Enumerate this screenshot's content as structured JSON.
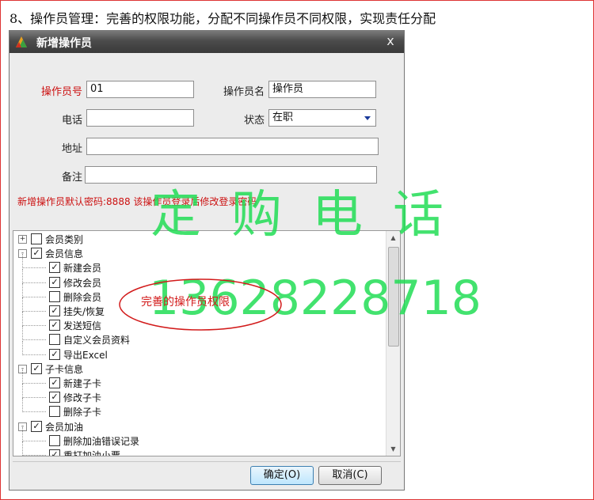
{
  "caption": "8、操作员管理：完善的权限功能，分配不同操作员不同权限，实现责任分配",
  "dialog": {
    "title": "新增操作员",
    "close_label": "x",
    "fields": {
      "op_no_label": "操作员号",
      "op_no_value": "01",
      "op_name_label": "操作员名",
      "op_name_value": "操作员",
      "phone_label": "电话",
      "phone_value": "",
      "status_label": "状态",
      "status_value": "在职",
      "address_label": "地址",
      "address_value": "",
      "remark_label": "备注",
      "remark_value": ""
    },
    "warning": "新增操作员默认密码:8888 该操作员登录后修改登录密码",
    "tree": [
      {
        "label": "会员类别",
        "checked": false,
        "level": 0,
        "expander": "+"
      },
      {
        "label": "会员信息",
        "checked": true,
        "level": 0,
        "expander": "-"
      },
      {
        "label": "新建会员",
        "checked": true,
        "level": 1
      },
      {
        "label": "修改会员",
        "checked": true,
        "level": 1
      },
      {
        "label": "删除会员",
        "checked": false,
        "level": 1
      },
      {
        "label": "挂失/恢复",
        "checked": true,
        "level": 1
      },
      {
        "label": "发送短信",
        "checked": true,
        "level": 1
      },
      {
        "label": "自定义会员资料",
        "checked": false,
        "level": 1
      },
      {
        "label": "导出Excel",
        "checked": true,
        "level": 1
      },
      {
        "label": "子卡信息",
        "checked": true,
        "level": 0,
        "expander": "-"
      },
      {
        "label": "新建子卡",
        "checked": true,
        "level": 1
      },
      {
        "label": "修改子卡",
        "checked": true,
        "level": 1
      },
      {
        "label": "删除子卡",
        "checked": false,
        "level": 1
      },
      {
        "label": "会员加油",
        "checked": true,
        "level": 0,
        "expander": "-"
      },
      {
        "label": "删除加油错误记录",
        "checked": false,
        "level": 1
      },
      {
        "label": "重打加油小票",
        "checked": true,
        "level": 1
      }
    ],
    "buttons": {
      "ok": "确定(O)",
      "cancel": "取消(C)"
    }
  },
  "watermark": {
    "line1": "定购电话",
    "line2": "13628228718"
  },
  "annotation": "完善的操作员权限",
  "colors": {
    "watermark": "#22dd55",
    "required_label": "#cc1111",
    "annotation": "#d21a1a"
  }
}
